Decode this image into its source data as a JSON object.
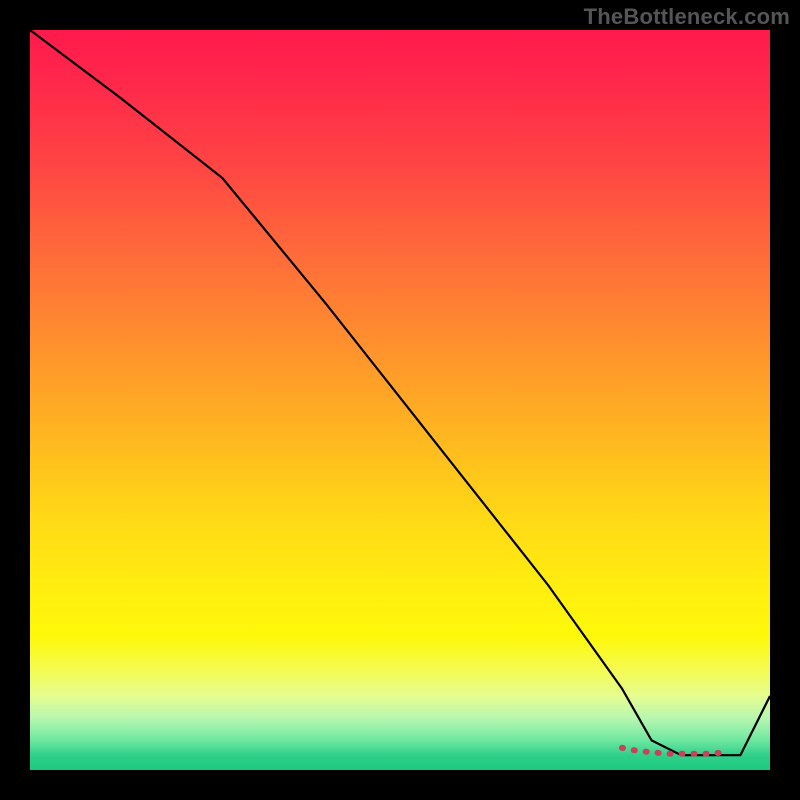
{
  "watermark": "TheBottleneck.com",
  "colors": {
    "background": "#000000",
    "line": "#000000",
    "dots": "#c9415a"
  },
  "chart_data": {
    "type": "line",
    "title": "",
    "xlabel": "",
    "ylabel": "",
    "xlim": [
      0,
      100
    ],
    "ylim": [
      0,
      100
    ],
    "grid": false,
    "series": [
      {
        "name": "curve",
        "x": [
          0,
          12,
          26,
          40,
          55,
          70,
          80,
          84,
          88,
          92,
          96,
          100
        ],
        "y": [
          100,
          91,
          80,
          63,
          44,
          25,
          11,
          4,
          2,
          2,
          2,
          10
        ]
      },
      {
        "name": "optimal-range-dots",
        "x": [
          80,
          82,
          84,
          86,
          88,
          90,
          92,
          94
        ],
        "y": [
          3,
          2.6,
          2.4,
          2.2,
          2.2,
          2.2,
          2.2,
          2.4
        ]
      }
    ]
  }
}
